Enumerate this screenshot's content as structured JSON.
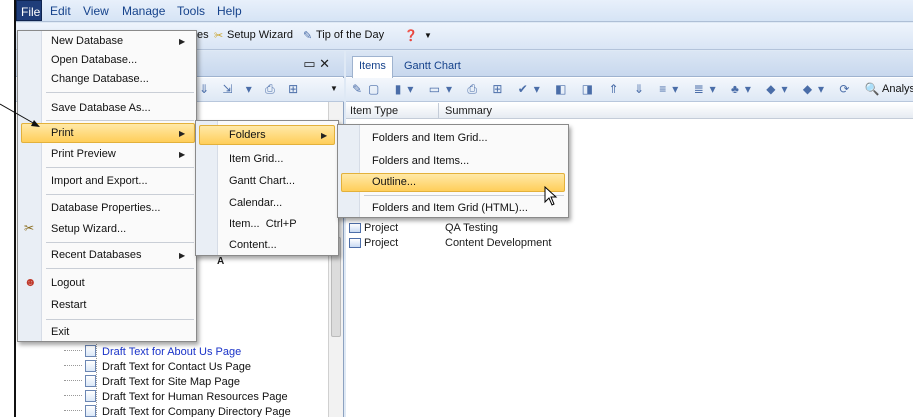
{
  "menubar": {
    "file": "File",
    "edit": "Edit",
    "view": "View",
    "manage": "Manage",
    "tools": "Tools",
    "help": "Help"
  },
  "toolbar": {
    "setup_wizard": "Setup Wizard",
    "tip_of_day": "Tip of the Day",
    "partial": "es"
  },
  "right_tabs": {
    "items": "Items",
    "gantt": "Gantt Chart"
  },
  "right_toolbar": {
    "analysis": "Analysis"
  },
  "grid": {
    "columns": {
      "item_type": "Item Type",
      "summary": "Summary"
    },
    "rows": [
      {
        "type": "Project",
        "summary": "QA Testing"
      },
      {
        "type": "Project",
        "summary": "Content Development"
      }
    ]
  },
  "tree": {
    "items": [
      "Draft Text for About Us Page",
      "Draft Text for Contact Us Page",
      "Draft Text for Site Map Page",
      "Draft Text for Human Resources Page",
      "Draft Text for Company Directory Page"
    ],
    "partial_label": "A"
  },
  "file_menu": {
    "new_database": "New Database",
    "open_database": "Open Database...",
    "change_database": "Change Database...",
    "save_database_as": "Save Database As...",
    "print": "Print",
    "print_preview": "Print Preview",
    "import_export": "Import and Export...",
    "database_properties": "Database Properties...",
    "setup_wizard": "Setup Wizard...",
    "recent_databases": "Recent Databases",
    "logout": "Logout",
    "restart": "Restart",
    "exit": "Exit"
  },
  "print_menu": {
    "folders": "Folders",
    "item_grid": "Item Grid...",
    "gantt_chart": "Gantt Chart...",
    "calendar": "Calendar...",
    "item": "Item...",
    "item_shortcut": "Ctrl+P",
    "content": "Content..."
  },
  "folders_menu": {
    "folders_item_grid": "Folders and Item Grid...",
    "folders_items": "Folders and Items...",
    "outline": "Outline...",
    "folders_item_grid_html": "Folders and Item Grid (HTML)..."
  },
  "colors": {
    "highlight": "#ffce5a",
    "menu_bg": "#fafafa",
    "app_bg": "#dfe9f5",
    "link_blue": "#1a33c8"
  }
}
